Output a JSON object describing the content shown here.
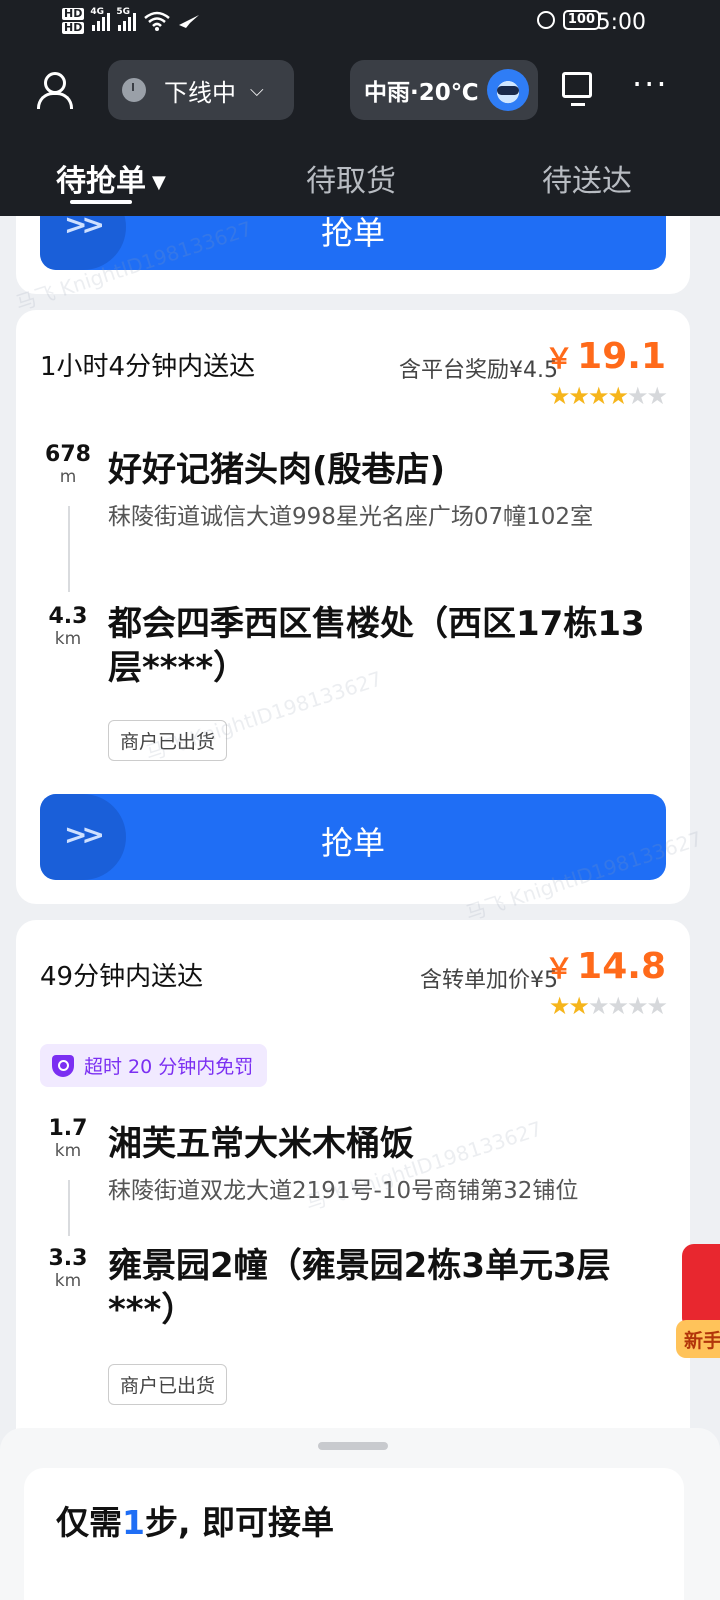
{
  "status_bar": {
    "time": "5:00",
    "battery": "100",
    "sim_labels": [
      "HD",
      "HD"
    ],
    "network": [
      "4G",
      "5G"
    ]
  },
  "header": {
    "online_status": "下线中",
    "weather": "中雨·20℃",
    "tabs": [
      {
        "label": "待抢单",
        "active": true
      },
      {
        "label": "待取货",
        "active": false
      },
      {
        "label": "待送达",
        "active": false
      }
    ]
  },
  "grab_label": "抢单",
  "orders": [
    {
      "deliver_time": "1小时4分钟内送达",
      "reward_note": "含平台奖励¥4.5",
      "price_symbol": "￥",
      "price": "19.1",
      "rating": 4,
      "rating_max": 6,
      "pickup": {
        "distance": "678",
        "unit": "m",
        "name": "好好记猪头肉(殷巷店)",
        "address": "秣陵街道诚信大道998星光名座广场07幢102室"
      },
      "dropoff": {
        "distance": "4.3",
        "unit": "km",
        "name": "都会四季西区售楼处（西区17栋13层****）"
      },
      "tag": "商户已出货"
    },
    {
      "deliver_time": "49分钟内送达",
      "reward_note": "含转单加价¥5",
      "price_symbol": "￥",
      "price": "14.8",
      "rating": 2,
      "rating_max": 6,
      "penalty_note": "超时 20 分钟内免罚",
      "pickup": {
        "distance": "1.7",
        "unit": "km",
        "name": "湘芙五常大米木桶饭",
        "address": "秣陵街道双龙大道2191号-10号商铺第32铺位"
      },
      "dropoff": {
        "distance": "3.3",
        "unit": "km",
        "name": "雍景园2幢（雍景园2栋3单元3层***）"
      },
      "tag": "商户已出货"
    }
  ],
  "side_gift_label": "新手",
  "bottom_sheet": {
    "prefix": "仅需",
    "step_num": "1",
    "suffix": "步, 即可接单"
  },
  "watermark": "马飞 KnightID198133627",
  "colors": {
    "accent": "#1f6ef5",
    "price": "#ff6a1a",
    "header_bg": "#1c1f24",
    "star": "#f6b51b",
    "penalty": "#7b2ff2"
  }
}
